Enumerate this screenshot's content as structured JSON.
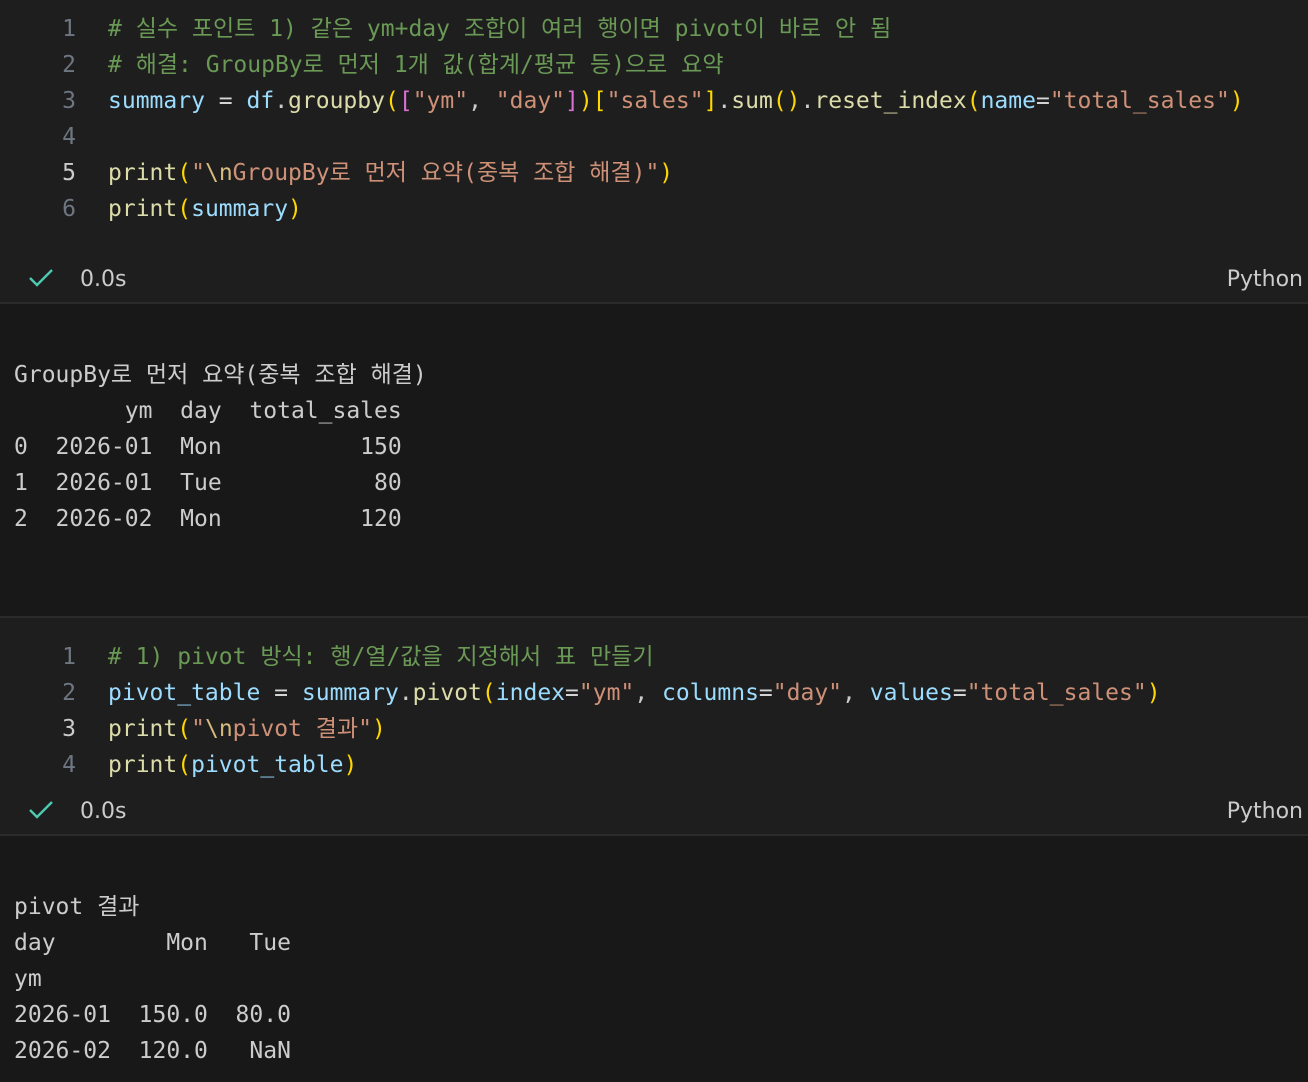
{
  "cell1": {
    "line_numbers": [
      "1",
      "2",
      "3",
      "4",
      "5",
      "6"
    ],
    "line1": "# 실수 포인트 1) 같은 ym+day 조합이 여러 행이면 pivot이 바로 안 됨",
    "line2": "# 해결: GroupBy로 먼저 1개 값(합계/평균 등)으로 요약",
    "line3": {
      "var": "summary",
      "eq": " = ",
      "df": "df",
      "dot1": ".",
      "fn1": "groupby",
      "p1": "(",
      "bk1": "[",
      "s1": "\"ym\"",
      "comma": ", ",
      "s2": "\"day\"",
      "bk2": "]",
      "p2": ")",
      "bk3": "[",
      "s3": "\"sales\"",
      "bk4": "]",
      "dot2": ".",
      "fn2": "sum",
      "p3": "()",
      "dot3": ".",
      "fn3": "reset_index",
      "p4": "(",
      "kw": "name",
      "eq2": "=",
      "s4": "\"total_sales\"",
      "p5": ")"
    },
    "line5": {
      "fn": "print",
      "p1": "(",
      "s_open": "\"",
      "esc": "\\n",
      "s_text": "GroupBy로 먼저 요약(중복 조합 해결)\"",
      "p2": ")"
    },
    "line6": {
      "fn": "print",
      "p1": "(",
      "arg": "summary",
      "p2": ")"
    },
    "duration": "0.0s",
    "language": "Python"
  },
  "output1": {
    "lines": [
      "GroupBy로 먼저 요약(중복 조합 해결)",
      "        ym  day  total_sales",
      "0  2026-01  Mon          150",
      "1  2026-01  Tue           80",
      "2  2026-02  Mon          120"
    ]
  },
  "cell2": {
    "line_numbers": [
      "1",
      "2",
      "3",
      "4"
    ],
    "line1": "# 1) pivot 방식: 행/열/값을 지정해서 표 만들기",
    "line2": {
      "var": "pivot_table",
      "eq": " = ",
      "obj": "summary",
      "dot": ".",
      "fn": "pivot",
      "p1": "(",
      "kw1": "index",
      "eq1": "=",
      "s1": "\"ym\"",
      "c1": ", ",
      "kw2": "columns",
      "eq2": "=",
      "s2": "\"day\"",
      "c2": ", ",
      "kw3": "values",
      "eq3": "=",
      "s3": "\"total_sales\"",
      "p2": ")"
    },
    "line3": {
      "fn": "print",
      "p1": "(",
      "s_open": "\"",
      "esc": "\\n",
      "s_text": "pivot 결과\"",
      "p2": ")"
    },
    "line4": {
      "fn": "print",
      "p1": "(",
      "arg": "pivot_table",
      "p2": ")"
    },
    "duration": "0.0s",
    "language": "Python"
  },
  "output2": {
    "lines": [
      "pivot 결과",
      "day        Mon   Tue",
      "ym",
      "2026-01  150.0  80.0",
      "2026-02  120.0   NaN"
    ]
  },
  "icons": {
    "success": "check-icon"
  },
  "colors": {
    "comment": "#6a9955",
    "function": "#dcdcaa",
    "variable": "#9cdcfe",
    "string": "#ce9178",
    "escape": "#d7ba7d",
    "bracket1": "#ffd700",
    "bracket2": "#da70d6",
    "success": "#4ec9b0"
  }
}
